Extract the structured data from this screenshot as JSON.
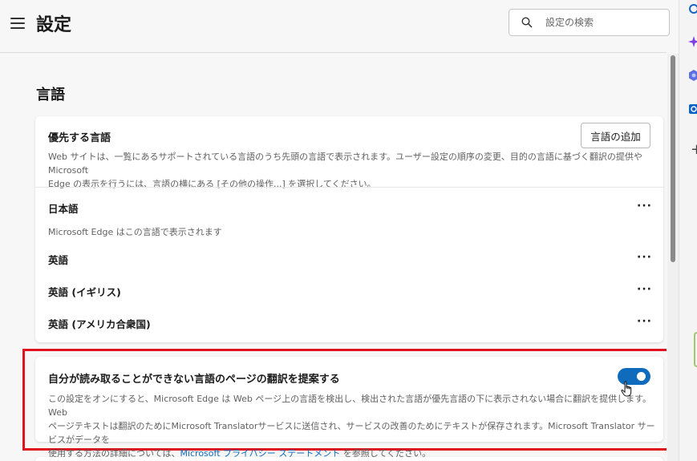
{
  "header": {
    "title": "設定",
    "search_placeholder": "設定の検索"
  },
  "section": {
    "title": "言語"
  },
  "preferred_languages": {
    "heading": "優先する言語",
    "add_button": "言語の追加",
    "description_line1": "Web サイトは、一覧にあるサポートされている言語のうち先頭の言語で表示されます。ユーザー設定の順序の変更、目的の言語に基づく翻訳の提供や Microsoft",
    "description_line2": "Edge の表示を行うには、言語の横にある [その他の操作...] を選択してください。",
    "languages": [
      {
        "name": "日本語",
        "sub": "Microsoft Edge はこの言語で表示されます"
      },
      {
        "name": "英語"
      },
      {
        "name": "英語 (イギリス)"
      },
      {
        "name": "英語 (アメリカ合衆国)"
      }
    ],
    "more_label": "···"
  },
  "translate": {
    "heading": "自分が読み取ることができない言語のページの翻訳を提案する",
    "enabled": true,
    "desc_line1": "この設定をオンにすると、Microsoft Edge は Web ページ上の言語を検出し、検出された言語が優先言語の下に表示されない場合に翻訳を提供します。Web",
    "desc_line2": "ページテキストは翻訳のためにMicrosoft Translatorサービスに送信され、サービスの改善のためにテキストが保存されます。Microsoft Translator サービスがデータを",
    "desc_line3_pre": "使用する方法の詳細については、",
    "desc_link": "Microsoft プライバシー ステートメント",
    "desc_line3_post": " を参照してください。"
  },
  "colors": {
    "accent": "#0f6cbd",
    "highlight": "#e0141f"
  },
  "icons": [
    "menu-icon",
    "search-icon",
    "more-icon",
    "toggle-switch",
    "hand-pointer-icon",
    "copilot-icon",
    "plus-icon"
  ]
}
